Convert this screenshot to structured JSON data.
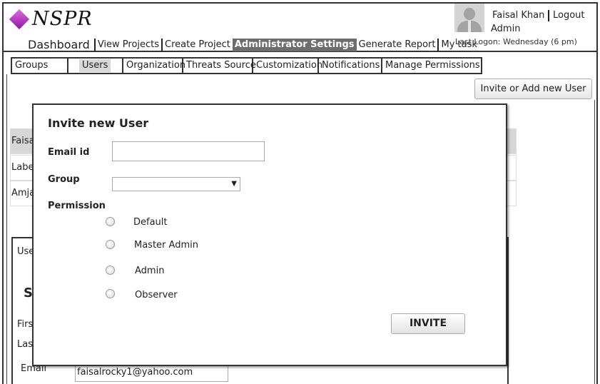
{
  "app": {
    "logo_text": "NSPR",
    "logo_icon": "purple-diamond",
    "accent_color": "#9b2bb0"
  },
  "nav": {
    "dashboard": "Dashboard",
    "view_projects": "View Projects",
    "create_project": "Create Project",
    "administrator_settings": "Administrator Settings",
    "generate_report": "Generate Report",
    "my_task": "My task",
    "active": "Administrator Settings"
  },
  "user": {
    "name": "Faisal Khan",
    "logout": "Logout",
    "role": "Admin",
    "last_logon": "Last Logon:  Wednesday (6 pm)",
    "avatar_icon": "user-silhouette-icon"
  },
  "tabs": {
    "groups": "Groups",
    "users": "Users",
    "organization": "Organization",
    "threats_source": "Threats Source",
    "customization": "Customization",
    "notifications": "Notifications",
    "manage_permissions": "Manage Permissions",
    "selected": "Users"
  },
  "actions": {
    "invite_or_add": "Invite or Add new User"
  },
  "background": {
    "rows": [
      "Faisa",
      "Labe",
      "Amja"
    ],
    "panel_label": "Use",
    "panel_heading": "S",
    "first_label": "Firs",
    "last_label": "Las",
    "email_label": "Email",
    "email_value": "faisalrocky1@yahoo.com"
  },
  "modal": {
    "title": "Invite new User",
    "email_label": "Email id",
    "email_value": "",
    "group_label": "Group",
    "group_value": "",
    "dropdown_icon": "triangle-down",
    "permission_label": "Permission",
    "permissions": [
      "Default",
      "Master Admin",
      "Admin",
      "Observer"
    ],
    "selected_permission": null,
    "submit": "INVITE"
  }
}
